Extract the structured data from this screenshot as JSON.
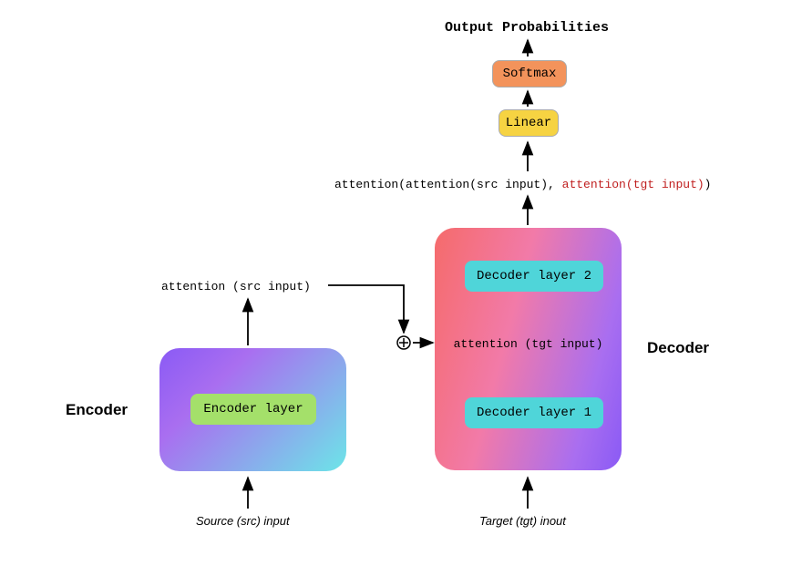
{
  "header": {
    "output_probabilities": "Output Probabilities"
  },
  "boxes": {
    "softmax": "Softmax",
    "linear": "Linear",
    "encoder_layer": "Encoder layer",
    "decoder_layer_1": "Decoder layer 1",
    "decoder_layer_2": "Decoder layer 2"
  },
  "labels": {
    "encoder": "Encoder",
    "decoder": "Decoder",
    "attention_src": "attention (src input)",
    "attention_tgt": "attention (tgt input)",
    "src_input": "Source (src) input",
    "tgt_input": "Target (tgt) inout"
  },
  "formula": {
    "prefix": "attention(attention(src input), ",
    "red": "attention(tgt input)",
    "suffix": ")"
  }
}
